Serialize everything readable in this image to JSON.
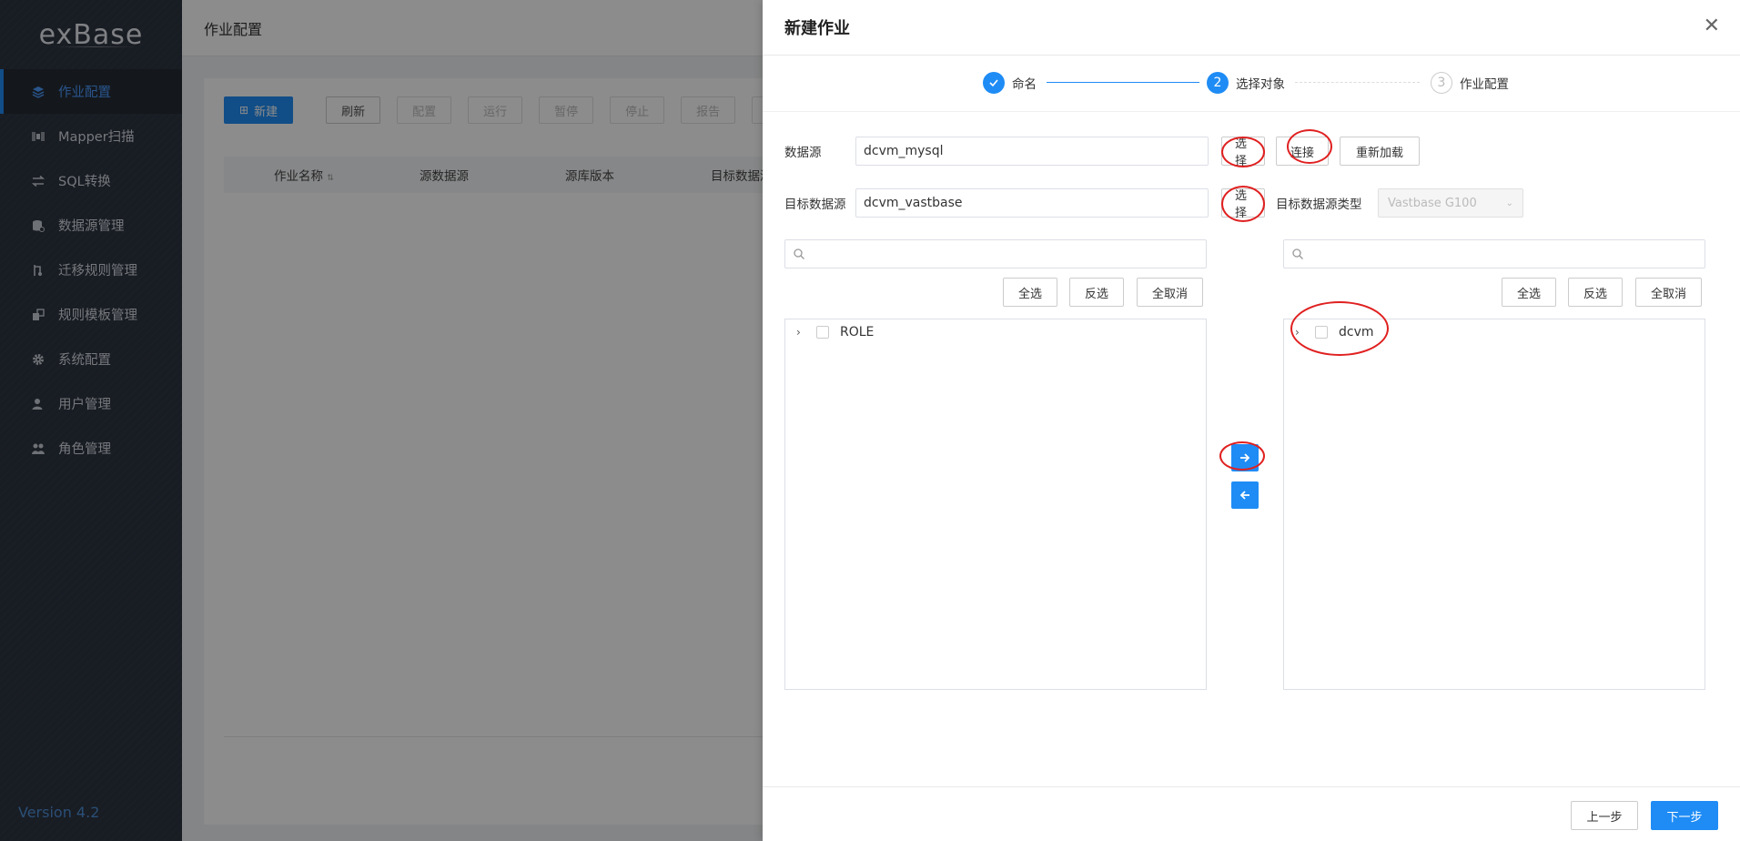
{
  "app": {
    "logo": "exBase",
    "version": "Version 4.2"
  },
  "sidebar": {
    "items": [
      {
        "label": "作业配置",
        "icon": "layers-icon",
        "active": true
      },
      {
        "label": "Mapper扫描",
        "icon": "scan-icon"
      },
      {
        "label": "SQL转换",
        "icon": "swap-icon"
      },
      {
        "label": "数据源管理",
        "icon": "database-icon"
      },
      {
        "label": "迁移规则管理",
        "icon": "rules-icon"
      },
      {
        "label": "规则模板管理",
        "icon": "template-icon"
      },
      {
        "label": "系统配置",
        "icon": "gear-icon"
      },
      {
        "label": "用户管理",
        "icon": "user-icon"
      },
      {
        "label": "角色管理",
        "icon": "users-icon"
      }
    ]
  },
  "main": {
    "title": "作业配置",
    "toolbar": {
      "new": "新建",
      "refresh": "刷新",
      "config": "配置",
      "run": "运行",
      "pause": "暂停",
      "stop": "停止",
      "report": "报告"
    },
    "columns": [
      "作业名称",
      "源数据源",
      "源库版本",
      "目标数据源"
    ]
  },
  "drawer": {
    "title": "新建作业",
    "steps": [
      {
        "num": "1",
        "label": "命名",
        "state": "done"
      },
      {
        "num": "2",
        "label": "选择对象",
        "state": "current"
      },
      {
        "num": "3",
        "label": "作业配置",
        "state": "pending"
      }
    ],
    "source": {
      "label": "数据源",
      "value": "dcvm_mysql",
      "select": "选择",
      "connect": "连接",
      "reload": "重新加载"
    },
    "target": {
      "label": "目标数据源",
      "value": "dcvm_vastbase",
      "select": "选择",
      "type_label": "目标数据源类型",
      "type_value": "Vastbase G100"
    },
    "left": {
      "select_all": "全选",
      "invert": "反选",
      "cancel_all": "全取消",
      "node": "ROLE"
    },
    "right": {
      "select_all": "全选",
      "invert": "反选",
      "cancel_all": "全取消",
      "node": "dcvm"
    },
    "footer": {
      "prev": "上一步",
      "next": "下一步"
    }
  },
  "colors": {
    "accent": "#1f8cf5",
    "sidebar_bg": "#2c3440",
    "annotation": "#e02020"
  }
}
